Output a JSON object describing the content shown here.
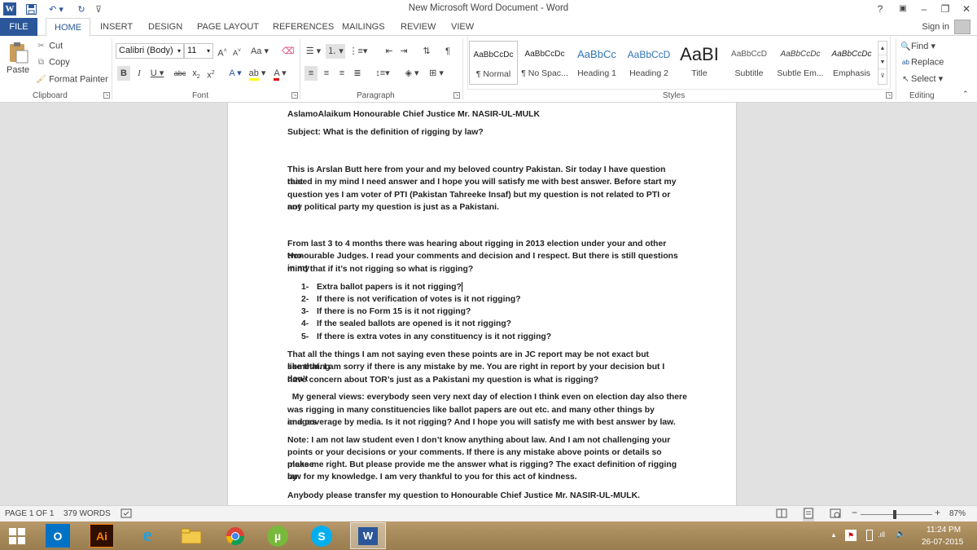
{
  "window": {
    "title": "New Microsoft Word Document - Word",
    "controls": {
      "help": "?",
      "minimize": "–",
      "restore": "❐",
      "close": "✕"
    }
  },
  "tabs": {
    "file": "FILE",
    "items": [
      "HOME",
      "INSERT",
      "DESIGN",
      "PAGE LAYOUT",
      "REFERENCES",
      "MAILINGS",
      "REVIEW",
      "VIEW"
    ],
    "active": "HOME",
    "sign_in": "Sign in"
  },
  "ribbon": {
    "clipboard": {
      "paste": "Paste",
      "cut": "Cut",
      "copy": "Copy",
      "format_painter": "Format Painter",
      "label": "Clipboard"
    },
    "font": {
      "name": "Calibri (Body)",
      "size": "11",
      "label": "Font",
      "change_case": "Aa"
    },
    "paragraph": {
      "label": "Paragraph"
    },
    "styles": {
      "label": "Styles",
      "items": [
        {
          "preview": "AaBbCcDc",
          "name": "¶ Normal"
        },
        {
          "preview": "AaBbCcDc",
          "name": "¶ No Spac..."
        },
        {
          "preview": "AaBbCc",
          "name": "Heading 1"
        },
        {
          "preview": "AaBbCcD",
          "name": "Heading 2"
        },
        {
          "preview": "AaBI",
          "name": "Title"
        },
        {
          "preview": "AaBbCcD",
          "name": "Subtitle"
        },
        {
          "preview": "AaBbCcDc",
          "name": "Subtle Em..."
        },
        {
          "preview": "AaBbCcDc",
          "name": "Emphasis"
        }
      ]
    },
    "editing": {
      "find": "Find",
      "replace": "Replace",
      "select": "Select",
      "label": "Editing"
    }
  },
  "document": {
    "greeting": "AslamoAlaikum Honourable Chief Justice Mr. NASIR-UL-MULK",
    "subject": "Subject: What is the definition of rigging by law?",
    "para1_lines": [
      "This is Arslan Butt here from your and my beloved country Pakistan. Sir today I have question that",
      "raised in my mind I need answer and I hope you will satisfy me with best answer. Before start my",
      "question yes I am voter of PTI (Pakistan Tahreeke Insaf) but my question is not related to PTI or not",
      "any political party my question is just as a Pakistani."
    ],
    "para2_lines": [
      "From last 3 to 4 months there was hearing about rigging in 2013 election under your and other two",
      "Honourable Judges. I read your comments and decision and I respect. But there is still questions in my",
      "mind that if it’s not rigging so what is rigging?"
    ],
    "list": [
      {
        "num": "1-",
        "text": "Extra ballot papers is it not rigging?"
      },
      {
        "num": "2-",
        "text": "If there is not verification of votes is it not rigging?"
      },
      {
        "num": "3-",
        "text": "If there is no Form 15 is it not rigging?"
      },
      {
        "num": "4-",
        "text": "If the sealed ballots are opened is it not rigging?"
      },
      {
        "num": "5-",
        "text": "If there is extra votes in any constituency is it not rigging?"
      }
    ],
    "para3_lines": [
      "That all the things I am not saying even these points are in JC report may be not exact but something",
      "like that. I am sorry if there is any mistake by me.  You are right in report by your decision but I don’t",
      "have concern about TOR’s just as a Pakistani my question is what is rigging?"
    ],
    "para4_lines": [
      "  My general views: everybody seen very next day of election I think even on election day also there",
      "was rigging in many constituencies like ballot papers are out etc. and many other things by images",
      "and coverage by media. Is it not rigging? And I hope you will satisfy me with best answer by law."
    ],
    "para5_lines": [
      "Note: I am not law student even I don’t know anything about law. And I am not challenging your",
      "points or your decisions or your comments. If there is any mistake above points or details so please",
      "make me right. But please provide me the answer what is rigging? The exact definition of rigging by",
      "law for my knowledge. I am very thankful to you for this act of kindness."
    ],
    "closing": "Anybody please transfer my question to Honourable Chief Justice Mr. NASIR-UL-MULK."
  },
  "statusbar": {
    "page": "PAGE 1 OF 1",
    "words": "379 WORDS",
    "zoom": "87%",
    "zoom_minus": "−",
    "zoom_plus": "+"
  },
  "taskbar": {
    "apps": [
      "start",
      "outlook",
      "illustrator",
      "internet-explorer",
      "file-explorer",
      "chrome",
      "utorrent",
      "skype",
      "word"
    ],
    "illustrator_label": "Ai",
    "time": "11:24 PM",
    "date": "26-07-2015"
  },
  "colors": {
    "word_blue": "#2b579a",
    "ribbon_bg": "#ffffff",
    "doc_bg": "#e1e1e1"
  }
}
